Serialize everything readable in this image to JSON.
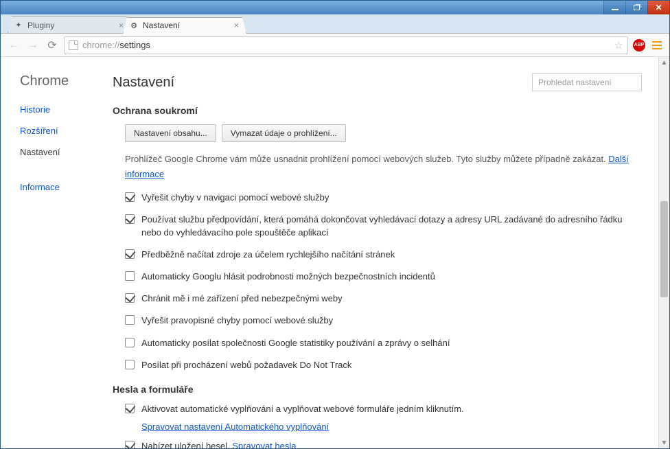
{
  "tabs": [
    {
      "title": "Pluginy",
      "active": false
    },
    {
      "title": "Nastavení",
      "active": true
    }
  ],
  "url": {
    "scheme": "chrome://",
    "path": "settings"
  },
  "sidebar": {
    "brand": "Chrome",
    "items": [
      "Historie",
      "Rozšíření",
      "Nastavení"
    ],
    "info": "Informace",
    "active_index": 2
  },
  "header": {
    "title": "Nastavení",
    "search_placeholder": "Prohledat nastavení"
  },
  "privacy": {
    "title": "Ochrana soukromí",
    "btn_content": "Nastavení obsahu...",
    "btn_clear": "Vymazat údaje o prohlížení...",
    "desc_a": "Prohlížeč Google Chrome vám může usnadnit prohlížení pomocí webových služeb. Tyto služby můžete případně zakázat. ",
    "desc_link": "Další informace",
    "items": [
      {
        "checked": true,
        "text": "Vyřešit chyby v navigaci pomocí webové služby"
      },
      {
        "checked": true,
        "text": "Používat službu předpovídání, která pomáhá dokončovat vyhledávací dotazy a adresy URL zadávané do adresního řádku nebo do vyhledávacího pole spouštěče aplikací"
      },
      {
        "checked": true,
        "text": "Předběžně načítat zdroje za účelem rychlejšího načítání stránek"
      },
      {
        "checked": false,
        "text": "Automaticky Googlu hlásit podrobnosti možných bezpečnostních incidentů"
      },
      {
        "checked": true,
        "text": "Chránit mě i mé zařízení před nebezpečnými weby"
      },
      {
        "checked": false,
        "text": "Vyřešit pravopisné chyby pomocí webové služby"
      },
      {
        "checked": false,
        "text": "Automaticky posílat společnosti Google statistiky používání a zprávy o selhání"
      },
      {
        "checked": false,
        "text": "Posílat při procházení webů požadavek Do Not Track"
      }
    ]
  },
  "passwords": {
    "title": "Hesla a formuláře",
    "item1": {
      "checked": true,
      "text": "Aktivovat automatické vyplňování a vyplňovat webové formuláře jedním kliknutím."
    },
    "link1": "Spravovat nastavení Automatického vyplňování",
    "item2": {
      "checked": true,
      "text": "Nabízet uložení hesel. "
    },
    "link2": "Spravovat hesla"
  },
  "ext": {
    "abp": "ABP"
  }
}
